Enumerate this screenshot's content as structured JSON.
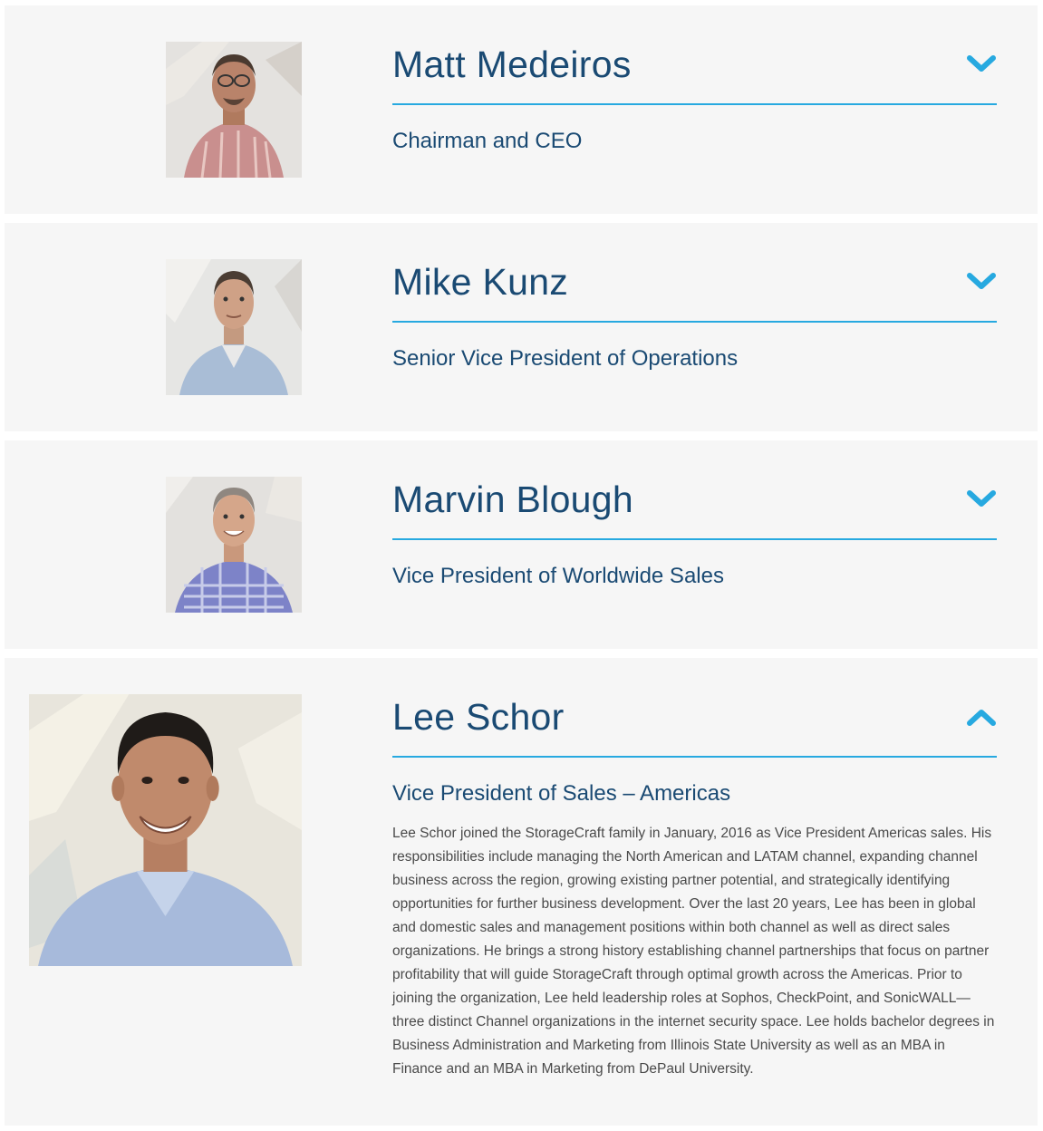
{
  "people": [
    {
      "name": "Matt Medeiros",
      "title": "Chairman and CEO",
      "expanded": false,
      "toggle_icon": "chevron-down-icon"
    },
    {
      "name": "Mike Kunz",
      "title": "Senior Vice President of Operations",
      "expanded": false,
      "toggle_icon": "chevron-down-icon"
    },
    {
      "name": "Marvin Blough",
      "title": "Vice President of Worldwide Sales",
      "expanded": false,
      "toggle_icon": "chevron-down-icon"
    },
    {
      "name": "Lee Schor",
      "title": "Vice President of Sales – Americas",
      "expanded": true,
      "toggle_icon": "chevron-up-icon",
      "bio": "Lee Schor joined the StorageCraft family in January, 2016 as Vice President Americas sales.  His responsibilities include managing the North American and LATAM channel, expanding channel business across the region, growing existing partner potential, and strategically identifying opportunities for further business development. Over the last 20 years, Lee has been in global and domestic sales and management positions within both channel as well as direct sales organizations. He brings a strong history establishing channel partnerships that focus on partner profitability that will guide StorageCraft through optimal growth across the Americas. Prior to joining the organization, Lee held leadership roles at Sophos, CheckPoint, and SonicWALL—three distinct Channel organizations in the internet security space. Lee holds bachelor degrees in Business Administration and Marketing from Illinois State University as well as an MBA in Finance and an MBA in Marketing from DePaul University."
    }
  ],
  "colors": {
    "accent": "#27a9e0",
    "name_text": "#1a4a73",
    "card_background": "#f6f6f6",
    "body_text": "#4a4a4a"
  }
}
